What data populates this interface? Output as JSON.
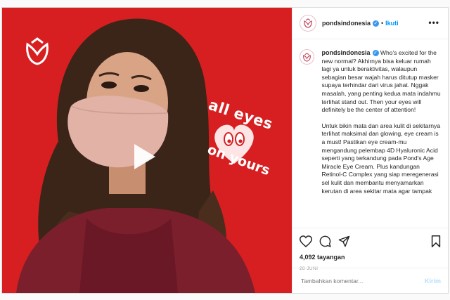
{
  "media": {
    "overlay_top": "all eyes",
    "overlay_bottom": "on yours"
  },
  "header": {
    "username": "pondsindonesia",
    "dot": "•",
    "follow_label": "Ikuti",
    "more_label": "•••"
  },
  "caption": {
    "username": "pondsindonesia",
    "paragraph1": "Who's excited for the new normal? Akhirnya bisa keluar rumah lagi ya untuk beraktivitas, walaupun sebagian besar wajah harus ditutup masker supaya terhindar dari virus jahat. Nggak masalah, yang penting kedua mata indahmu terlihat stand out. Then your eyes will definitely be the center of attention!",
    "paragraph2": "Untuk bikin mata dan area kulit di sekitarnya terlihat maksimal dan glowing, eye cream is a must! Pastikan eye cream-mu mengandung pelembap 4D Hyaluronic Acid seperti yang terkandung pada Pond's Age Miracle Eye Cream. Plus kandungan Retinol-C Complex yang siap meregenerasi sel kulit dan membantu menyamarkan kerutan di area sekitar mata agar tampak"
  },
  "stats": {
    "views": "4,092 tayangan",
    "date": "28 JUNI"
  },
  "comment": {
    "placeholder": "Tambahkan komentar...",
    "post_label": "Kirim"
  },
  "colors": {
    "brand_red": "#d71f21",
    "verified_blue": "#3897f0",
    "link_blue": "#0095f6",
    "pond_pink": "#c2425d"
  }
}
